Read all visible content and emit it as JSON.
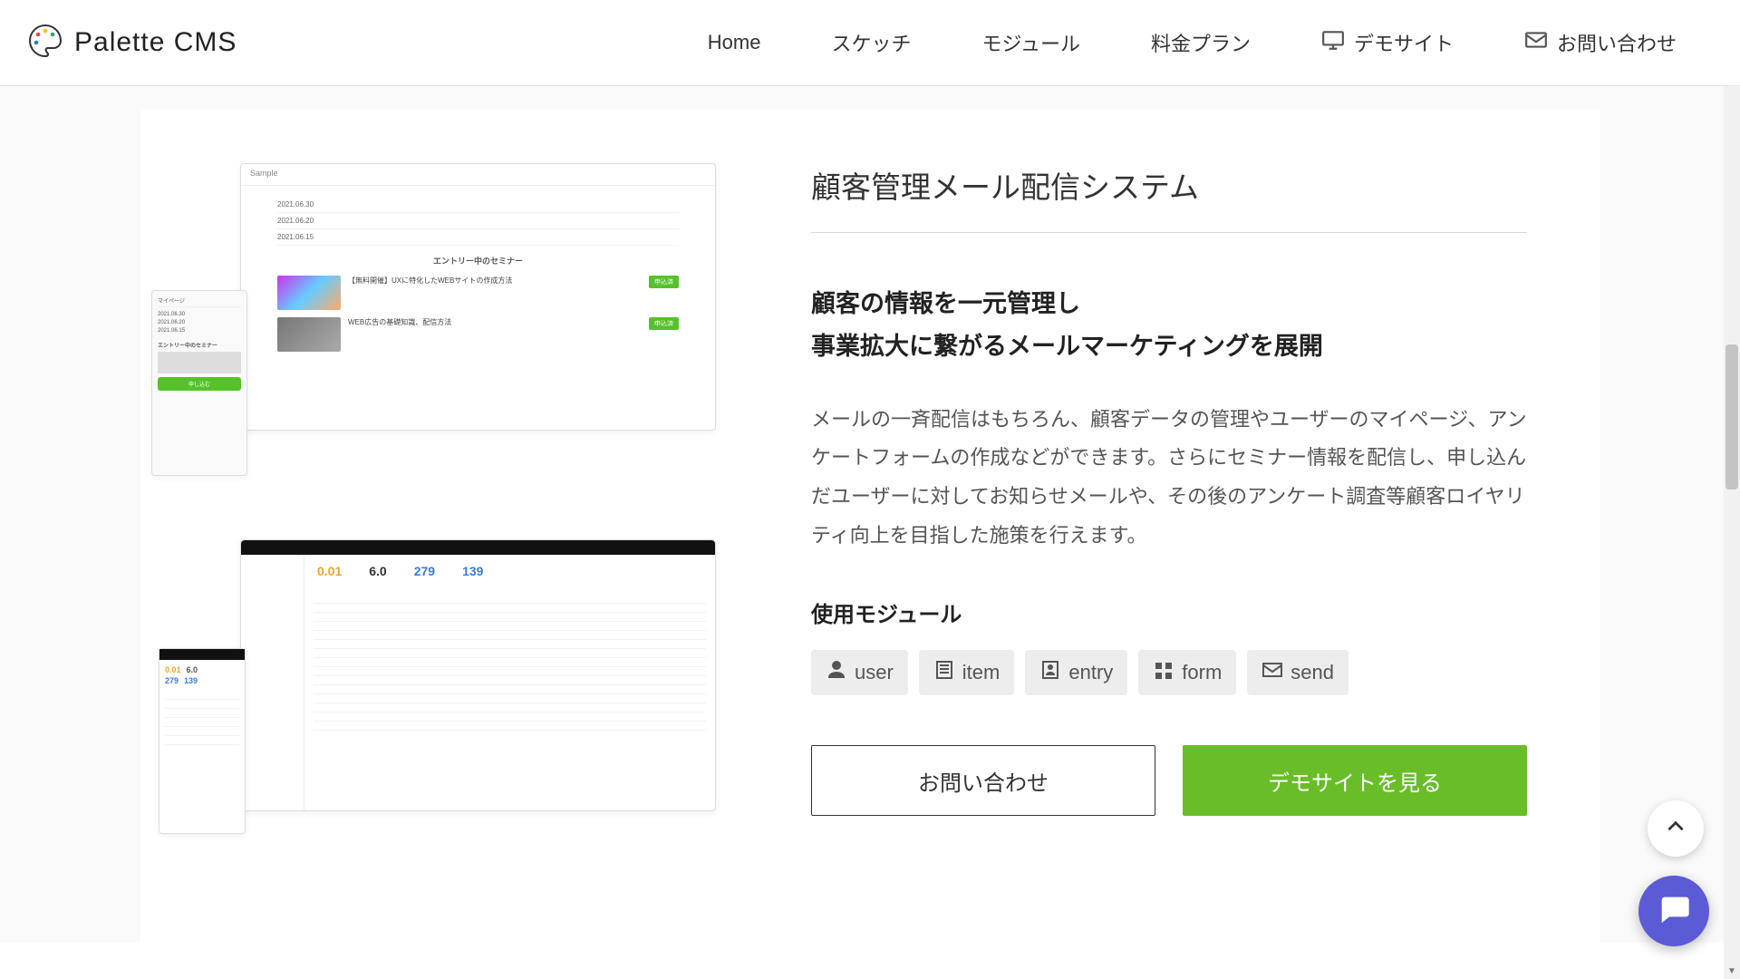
{
  "brand": {
    "name": "Palette CMS"
  },
  "nav": {
    "home": "Home",
    "sketch": "スケッチ",
    "module": "モジュール",
    "plan": "料金プラン",
    "demo": "デモサイト",
    "contact": "お問い合わせ"
  },
  "section": {
    "title": "顧客管理メール配信システム",
    "subhead_line1": "顧客の情報を一元管理し",
    "subhead_line2": "事業拡大に繋がるメールマーケティングを展開",
    "body": "メールの一斉配信はもちろん、顧客データの管理やユーザーのマイページ、アンケートフォームの作成などができます。さらにセミナー情報を配信し、申し込んだユーザーに対してお知らせメールや、その後のアンケート調査等顧客ロイヤリティ向上を目指した施策を行えます。",
    "modules_label": "使用モジュール",
    "modules": [
      {
        "key": "user",
        "label": "user"
      },
      {
        "key": "item",
        "label": "item"
      },
      {
        "key": "entry",
        "label": "entry"
      },
      {
        "key": "form",
        "label": "form"
      },
      {
        "key": "send",
        "label": "send"
      }
    ],
    "cta_contact": "お問い合わせ",
    "cta_demo": "デモサイトを見る"
  },
  "shots": {
    "sample_title": "Sample",
    "seminar_section": "エントリー中のセミナー",
    "entry1": "【無料開催】UXに特化したWEBサイトの作成方法",
    "entry2": "WEB広告の基礎知識、配信方法",
    "metric1": "0.01",
    "metric2": "6.0",
    "metric3": "279",
    "metric4": "139"
  }
}
